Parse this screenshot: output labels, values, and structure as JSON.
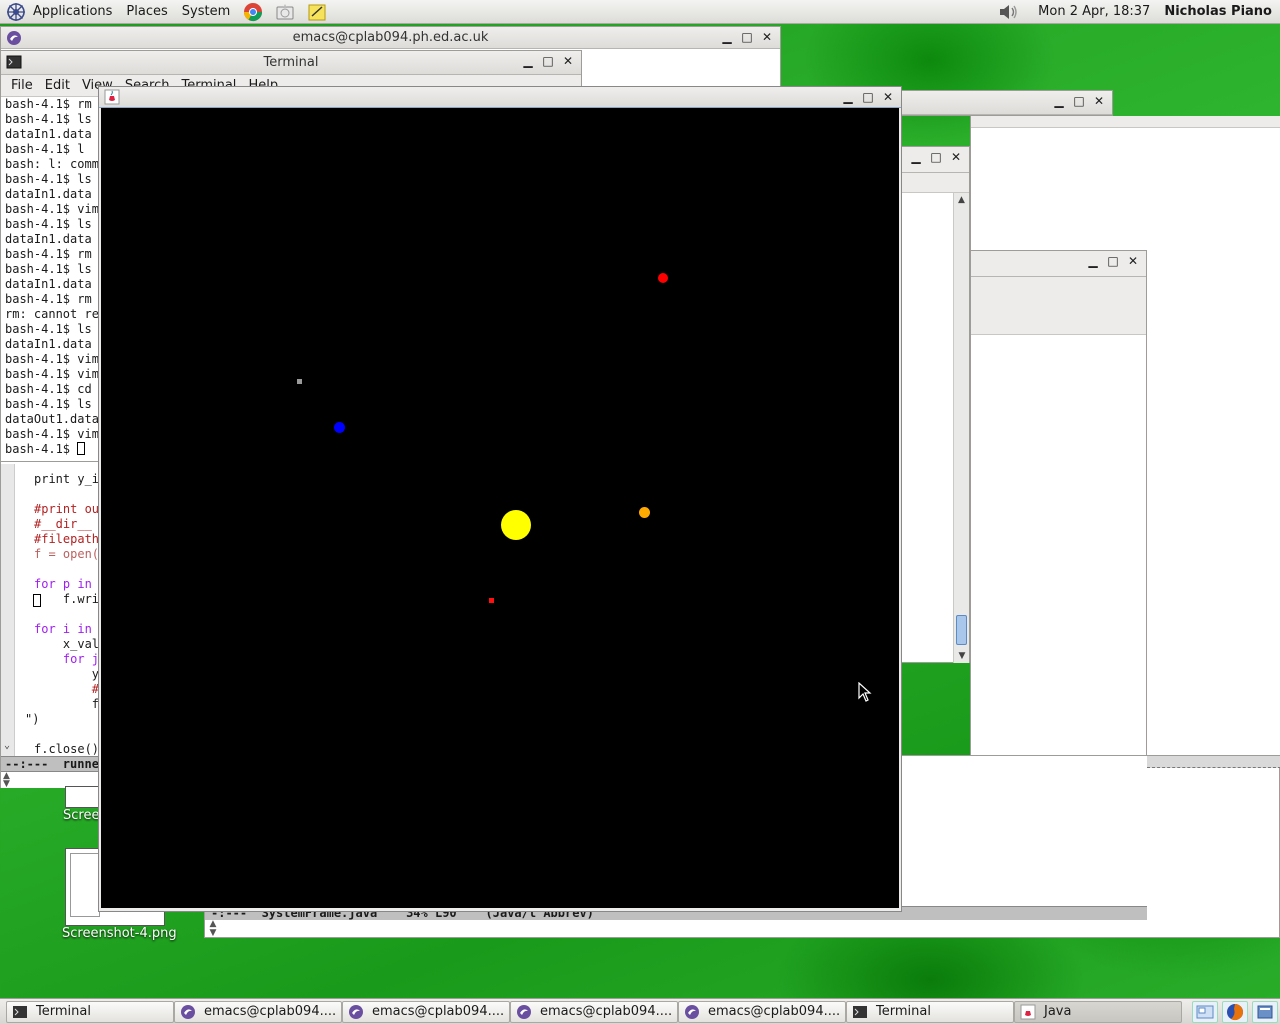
{
  "top_panel": {
    "menus": [
      "Applications",
      "Places",
      "System"
    ],
    "clock": "Mon  2 Apr, 18:37",
    "user": "Nicholas Piano"
  },
  "emacs_window": {
    "title": "emacs@cplab094.ph.ed.ac.uk",
    "code_lines": [
      {
        "text": "print y_i"
      },
      {
        "text": ""
      },
      {
        "text": "#print out"
      },
      {
        "text": "#__dir__ ="
      },
      {
        "text": "#filepath"
      },
      {
        "text": "f = open("
      },
      {
        "text": ""
      },
      {
        "text": "for p in"
      },
      {
        "text": "    f.wri"
      },
      {
        "text": ""
      },
      {
        "text": "for i in"
      },
      {
        "text": "    x_val"
      },
      {
        "text": "    for j"
      },
      {
        "text": "        y"
      },
      {
        "text": "        #"
      },
      {
        "text": "        f"
      },
      {
        "text": "\")"
      },
      {
        "text": ""
      },
      {
        "text": "f.close()"
      }
    ],
    "modeline": "--:---  runner"
  },
  "terminal_window": {
    "title": "Terminal",
    "menu": [
      "File",
      "Edit",
      "View",
      "Search",
      "Terminal",
      "Help"
    ],
    "lines": [
      "bash-4.1$ rm",
      "bash-4.1$ ls",
      "dataIn1.data",
      "bash-4.1$ l",
      "bash: l: comma",
      "bash-4.1$ ls",
      "dataIn1.data",
      "bash-4.1$ vim",
      "bash-4.1$ ls",
      "dataIn1.data",
      "bash-4.1$ rm",
      "bash-4.1$ ls",
      "dataIn1.data",
      "bash-4.1$ rm",
      "rm: cannot rem",
      "bash-4.1$ ls",
      "dataIn1.data",
      "bash-4.1$ vim",
      "bash-4.1$ vim",
      "bash-4.1$ cd",
      "bash-4.1$ ls",
      "dataOut1.data",
      "bash-4.1$ vim"
    ],
    "prompt": "bash-4.1$ "
  },
  "emacs2_window": {
    "modeline": "-:---  SystemFrame.java    34% L90    (Java/l Abbrev)"
  },
  "desktop_icons": [
    {
      "label": "Scree"
    },
    {
      "label": "Screenshot-4.png"
    }
  ],
  "java_window": {
    "title": "",
    "bodies": [
      {
        "name": "sun",
        "color": "#ffff00"
      },
      {
        "name": "planet-red-1",
        "color": "#ff0000"
      },
      {
        "name": "planet-grey",
        "color": "#9a9a9a"
      },
      {
        "name": "planet-blue",
        "color": "#0000ff"
      },
      {
        "name": "planet-orange",
        "color": "#ffaa00"
      },
      {
        "name": "planet-red-2",
        "color": "#ff1010"
      }
    ]
  },
  "taskbar": {
    "tasks": [
      {
        "label": "Terminal",
        "icon": "terminal-icon"
      },
      {
        "label": "emacs@cplab094....",
        "icon": "emacs-icon"
      },
      {
        "label": "emacs@cplab094....",
        "icon": "emacs-icon"
      },
      {
        "label": "emacs@cplab094....",
        "icon": "emacs-icon"
      },
      {
        "label": "emacs@cplab094....",
        "icon": "emacs-icon"
      },
      {
        "label": "Terminal",
        "icon": "terminal-icon"
      },
      {
        "label": "Java",
        "icon": "java-icon"
      }
    ]
  },
  "colors": {
    "desktop_green": "#22a322",
    "java_canvas": "#000000"
  }
}
